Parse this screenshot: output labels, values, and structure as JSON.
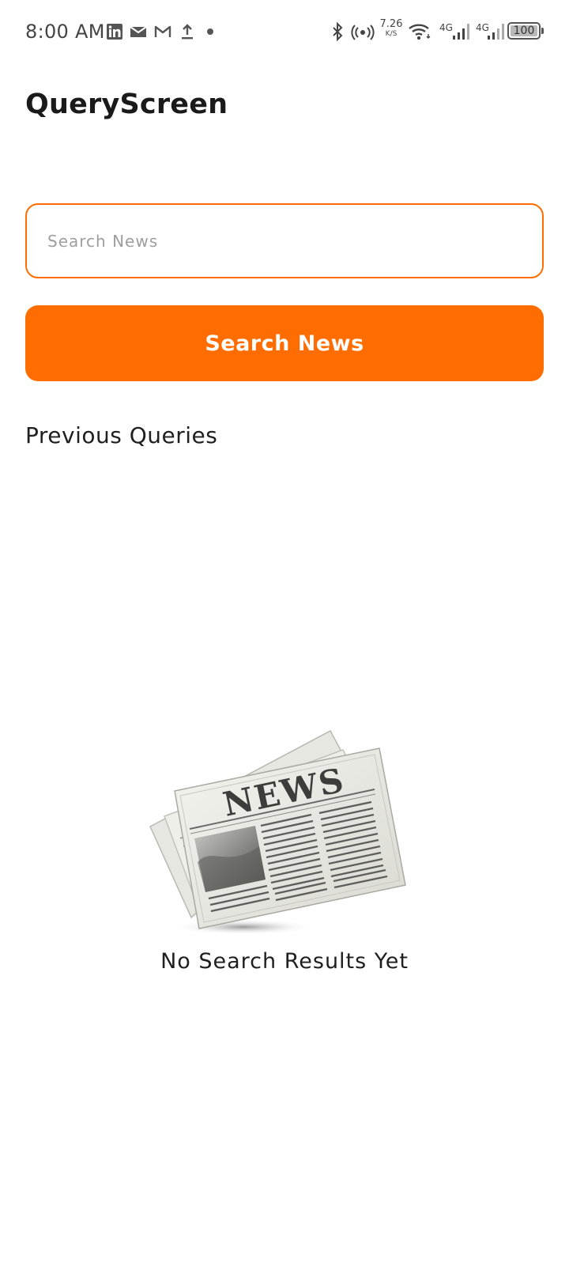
{
  "status_bar": {
    "time": "8:00 AM",
    "notification_icons": [
      "linkedin-icon",
      "gmail-icon",
      "gmail-icon",
      "upload-icon",
      "dot-icon"
    ],
    "net_speed_value": "7.26",
    "net_speed_unit": "K/S",
    "network_label_1": "4G",
    "network_label_2": "4G",
    "battery_level": "100"
  },
  "header": {
    "title": "QueryScreen"
  },
  "search": {
    "placeholder": "Search News",
    "value": "",
    "button_label": "Search News"
  },
  "history": {
    "heading": "Previous Queries",
    "items": []
  },
  "empty_state": {
    "illustration_word": "NEWS",
    "message": "No Search Results Yet"
  },
  "colors": {
    "accent": "#ff6d00",
    "text": "#1c1c1c",
    "placeholder": "#9e9e9e"
  }
}
